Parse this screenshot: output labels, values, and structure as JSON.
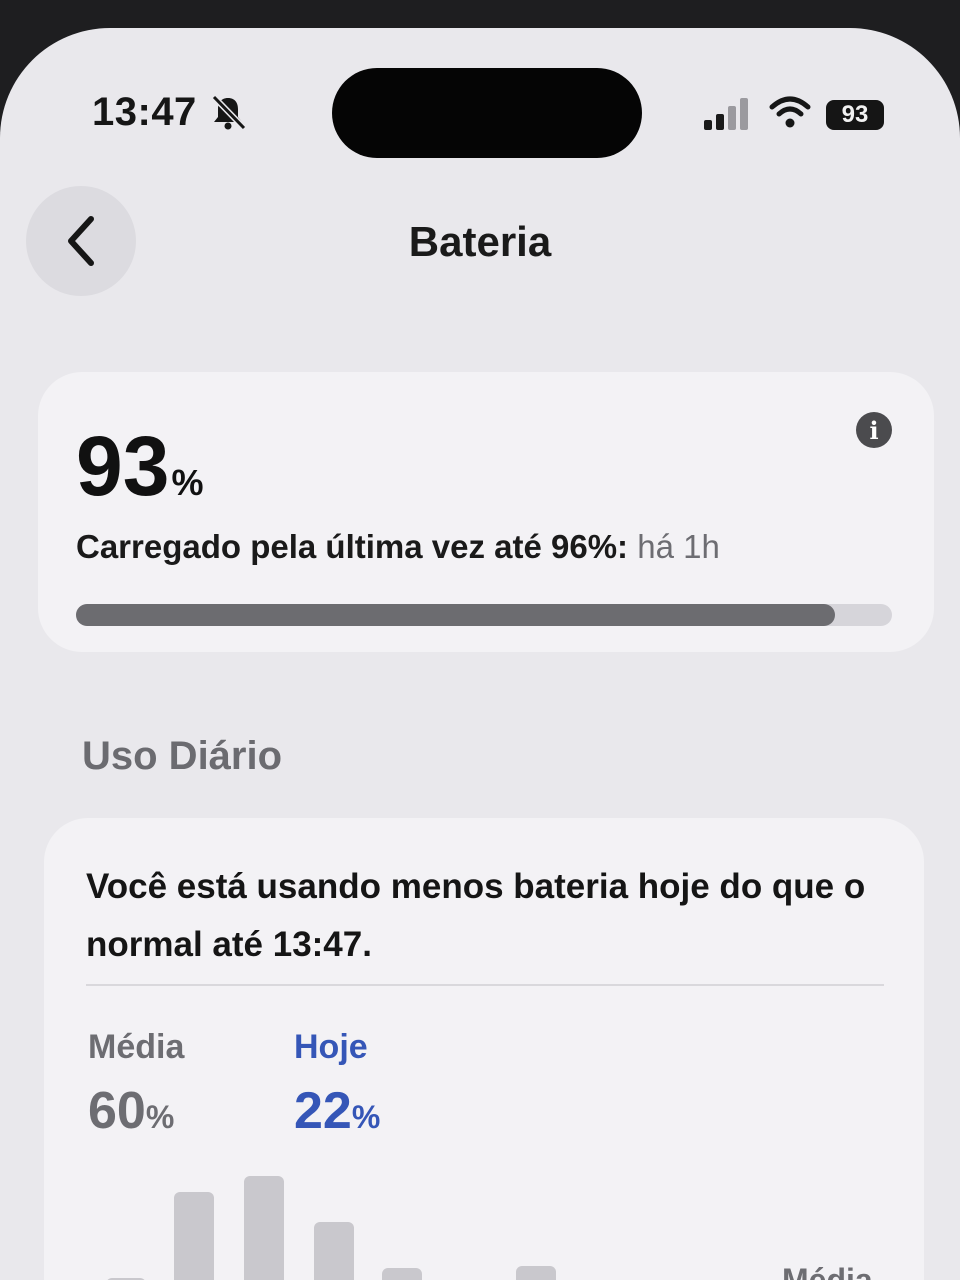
{
  "status_bar": {
    "time": "13:47",
    "silent_icon": "bell-slash-icon",
    "signal_icon": "cellular-signal-icon",
    "wifi_icon": "wifi-icon",
    "battery_level": "93"
  },
  "nav": {
    "back_icon": "chevron-left-icon",
    "title": "Bateria"
  },
  "battery_card": {
    "level_value": "93",
    "level_unit": "%",
    "info_icon": "i",
    "last_charge_text": "Carregado pela última vez até 96%:",
    "last_charge_ago": "há 1h",
    "progress_fraction": 0.93
  },
  "daily_usage": {
    "section_title": "Uso Diário",
    "message": "Você está usando menos bateria hoje do que o normal até 13:47.",
    "average_label": "Média",
    "average_value": "60",
    "average_unit": "%",
    "today_label": "Hoje",
    "today_value": "22",
    "today_unit": "%",
    "chart_average_tag": "Média"
  },
  "colors": {
    "today_accent": "#3556b7",
    "progress_fill": "#6c6c70"
  }
}
